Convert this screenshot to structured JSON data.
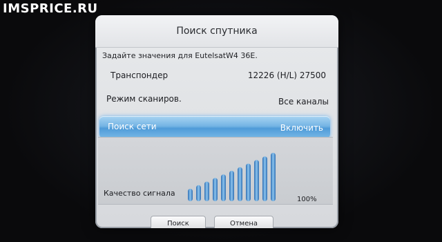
{
  "watermark": "IMSPRICE.RU",
  "dialog": {
    "title": "Поиск спутника",
    "prompt": "Задайте значения для EutelsatW4 36E.",
    "rows": [
      {
        "label": "Транспондер",
        "value": "12226 (H/L) 27500"
      },
      {
        "label": "Режим сканиров.",
        "value": "Все каналы"
      },
      {
        "label": "Поиск сети",
        "value": "Включить",
        "selected": true
      }
    ],
    "signal": {
      "label": "Качество сигнала",
      "value": "100%",
      "level_fraction": 1.0,
      "bar_count": 11
    },
    "buttons": {
      "search": "Поиск",
      "cancel": "Отмена"
    }
  },
  "colors": {
    "highlight": "#5ea6dc",
    "bar_fill": "#4a8fd0",
    "dialog_bg": "#e2e4e7"
  }
}
